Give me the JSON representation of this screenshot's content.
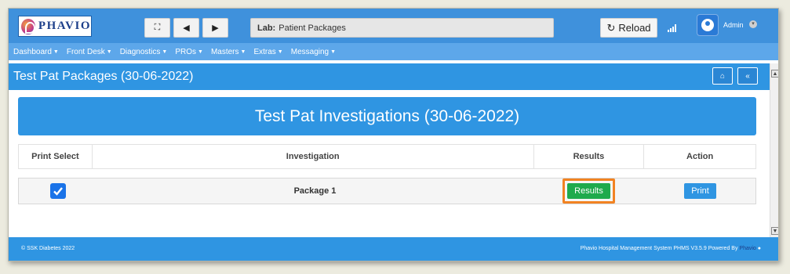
{
  "app": {
    "logo_text": "PHAVIO"
  },
  "toolbar": {
    "breadcrumb_prefix": "Lab:",
    "breadcrumb_page": "Patient Packages",
    "reload_label": "Reload",
    "user_name": "Admin"
  },
  "nav": {
    "items": [
      "Dashboard",
      "Front Desk",
      "Diagnostics",
      "PROs",
      "Masters",
      "Extras",
      "Messaging"
    ]
  },
  "page": {
    "title": "Test Pat Packages (30-06-2022)",
    "investigations_title": "Test Pat Investigations (30-06-2022)"
  },
  "table": {
    "headers": [
      "Print Select",
      "Investigation",
      "Results",
      "Action"
    ],
    "rows": [
      {
        "checked": true,
        "investigation": "Package 1",
        "results_label": "Results",
        "action_label": "Print"
      }
    ]
  },
  "footer": {
    "left": "© SSK Diabetes 2022",
    "right": "Phavio Hospital Management System PHMS V3.5.9 Powered By",
    "right_link": "Phavio"
  },
  "colors": {
    "primary": "#2f95e2",
    "nav": "#5da7ea",
    "results_button": "#1faa4c",
    "highlight": "#f28322"
  }
}
